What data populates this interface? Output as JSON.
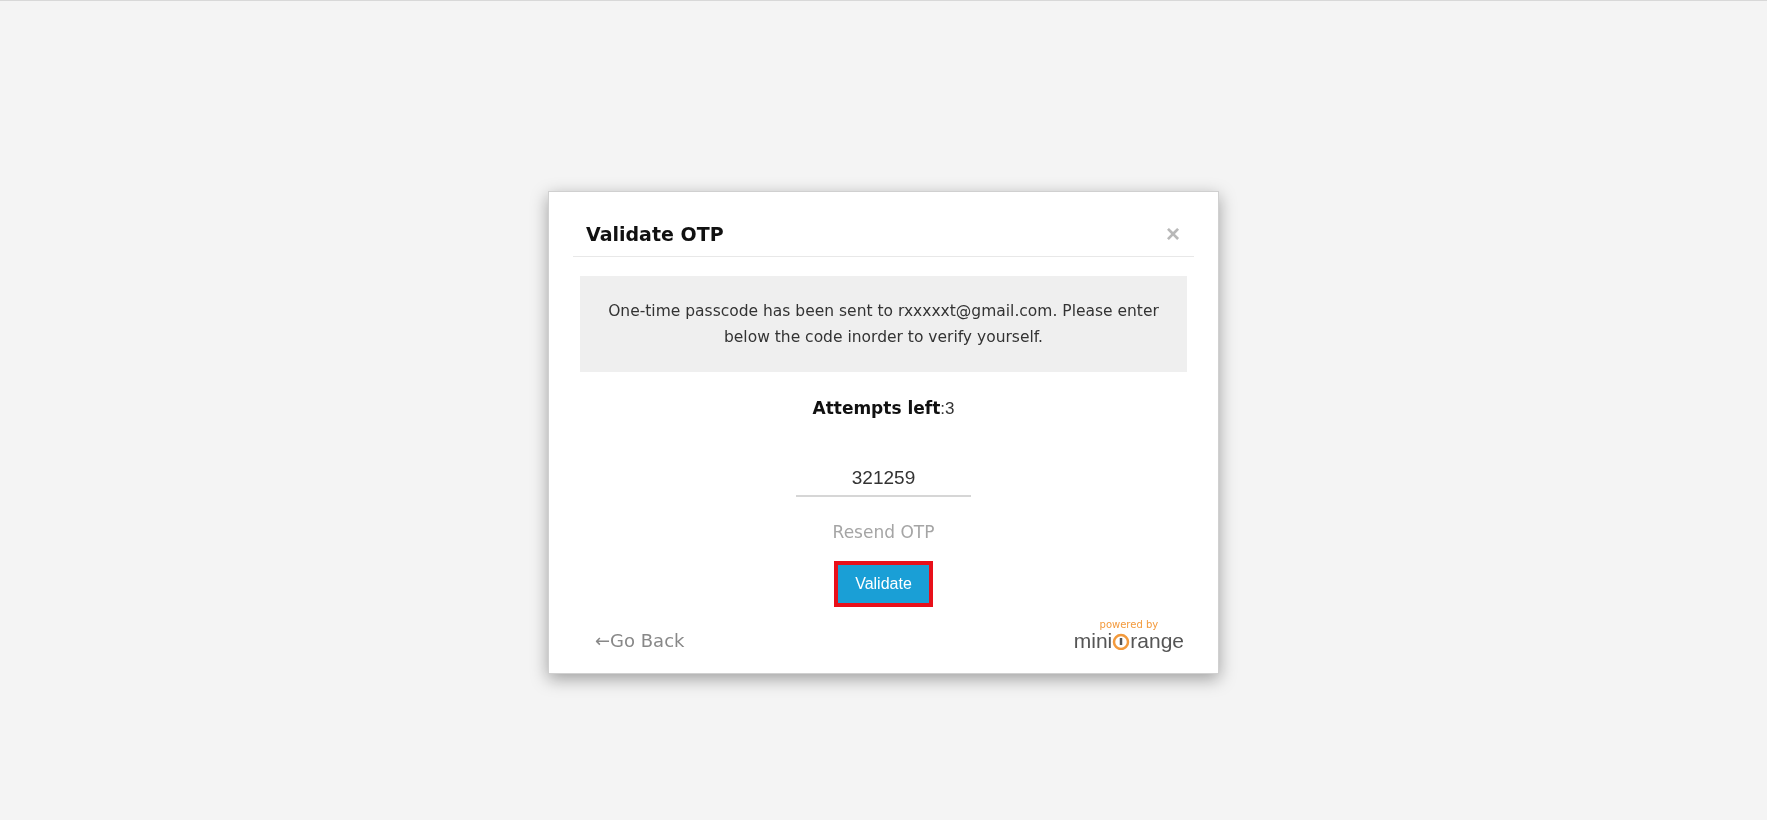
{
  "dialog": {
    "title": "Validate OTP",
    "close": "×",
    "message": "One-time passcode has been sent to rxxxxxt@gmail.com. Please enter below the code inorder to verify yourself.",
    "attempts": {
      "label": "Attempts left",
      "value": ":3"
    },
    "otp_field": {
      "value": "321259"
    },
    "resend_link": "Resend OTP",
    "validate_button": {
      "label": "Validate",
      "highlighted": true
    },
    "back_link": {
      "arrow": "←",
      "label": "Go Back"
    },
    "logo": {
      "tagline": "powered by",
      "before": "mini",
      "after": "range"
    }
  }
}
